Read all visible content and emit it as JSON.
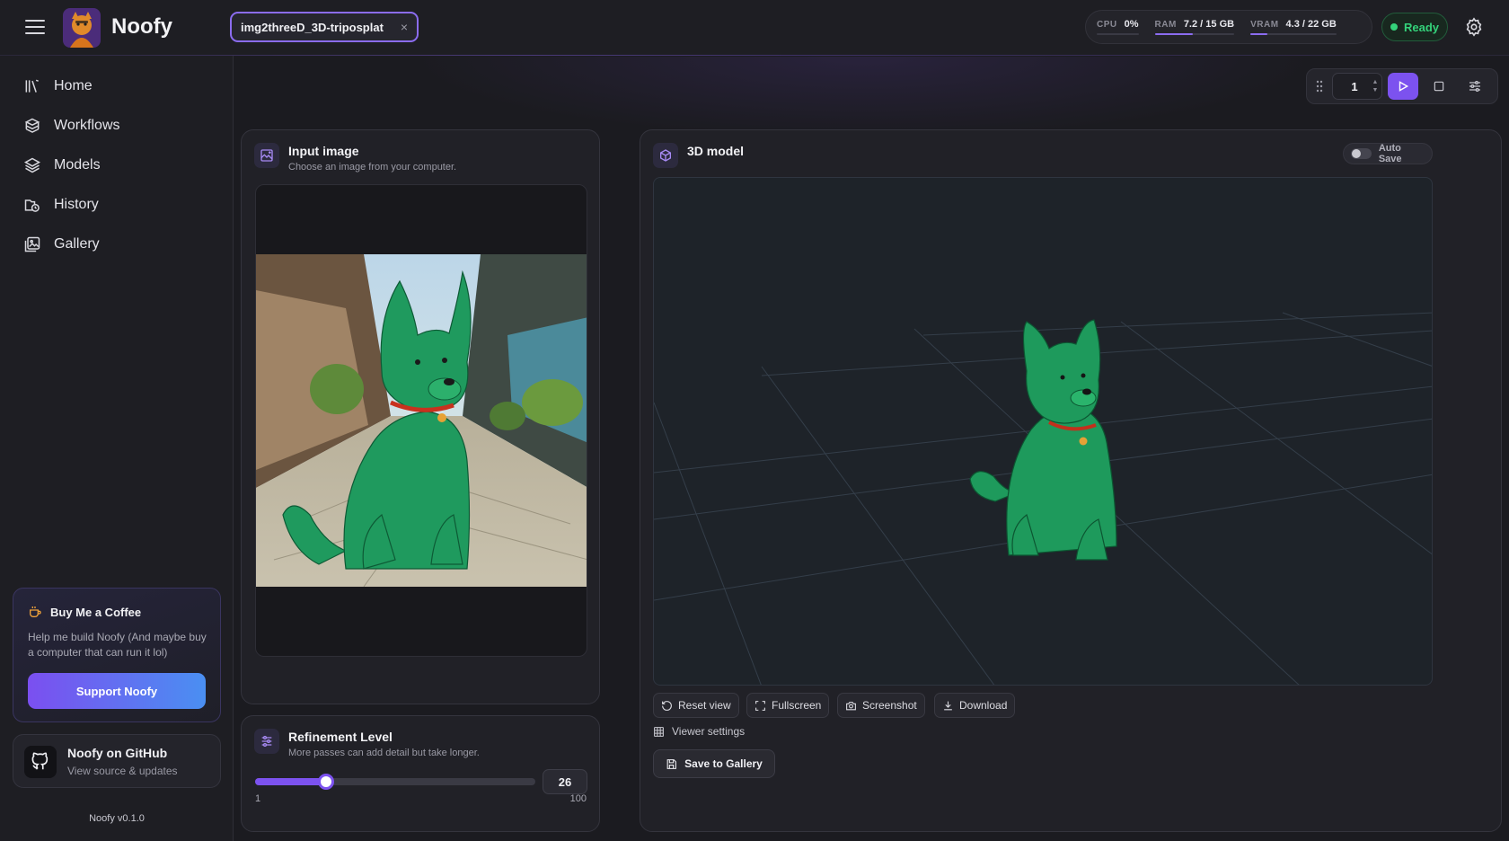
{
  "app": {
    "name": "Noofy",
    "version": "Noofy v0.1.0"
  },
  "header": {
    "tab_label": "img2threeD_3D-triposplat",
    "tab_close": "×",
    "stats": {
      "cpu_label": "CPU",
      "cpu_value": "0%",
      "cpu_fraction": 0.0,
      "ram_label": "RAM",
      "ram_value": "7.2 / 15 GB",
      "ram_fraction": 0.48,
      "vram_label": "VRAM",
      "vram_value": "4.3 / 22 GB",
      "vram_fraction": 0.2
    },
    "status": "Ready",
    "status_color": "#34d27a"
  },
  "sidebar": {
    "items": [
      {
        "label": "Home",
        "icon": "library-icon"
      },
      {
        "label": "Workflows",
        "icon": "workflows-icon"
      },
      {
        "label": "Models",
        "icon": "layers-icon"
      },
      {
        "label": "History",
        "icon": "history-icon"
      },
      {
        "label": "Gallery",
        "icon": "gallery-icon"
      }
    ],
    "coffee": {
      "title": "Buy Me a Coffee",
      "description": "Help me build Noofy (And maybe buy a computer that can run it lol)",
      "button": "Support Noofy"
    },
    "github": {
      "title": "Noofy on GitHub",
      "subtitle": "View source & updates"
    }
  },
  "toolbar": {
    "count": "1",
    "play_icon": "play-icon",
    "accent": "#7c52ef"
  },
  "input_panel": {
    "title": "Input image",
    "subtitle": "Choose an image from your computer."
  },
  "refinement_panel": {
    "title": "Refinement Level",
    "subtitle": "More passes can add detail but take longer.",
    "value": "26",
    "min": "1",
    "max": "100"
  },
  "model_panel": {
    "title": "3D model",
    "auto_save": "Auto Save",
    "auto_save_on": false,
    "buttons": {
      "reset": "Reset view",
      "fullscreen": "Fullscreen",
      "screenshot": "Screenshot",
      "download": "Download"
    },
    "viewer_settings": "Viewer settings",
    "save_gallery": "Save to Gallery"
  }
}
